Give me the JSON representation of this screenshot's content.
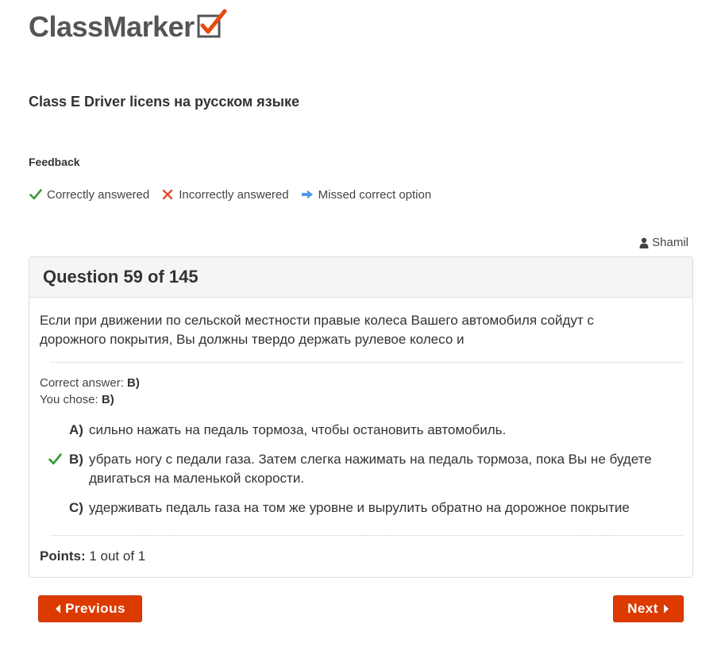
{
  "brand": {
    "name": "ClassMarker",
    "check_color": "#e8490f",
    "text_color": "#555555"
  },
  "quiz": {
    "title": "Class E Driver licens на русском языке"
  },
  "feedback": {
    "title": "Feedback",
    "legend": [
      {
        "icon": "check-icon",
        "label": "Correctly answered",
        "color": "#3c9a3c"
      },
      {
        "icon": "cross-icon",
        "label": "Incorrectly answered",
        "color": "#e24c2c"
      },
      {
        "icon": "arrow-right-icon",
        "label": "Missed correct option",
        "color": "#4d9be6"
      }
    ]
  },
  "user": {
    "icon": "user-icon",
    "name": "Shamil"
  },
  "question": {
    "heading": "Question 59 of 145",
    "text": "Если при движении по сельской местности правые колеса Вашего автомобиля сойдут с дорожного покрытия, Вы должны твердо держать рулевое колесо и",
    "correct_label": "Correct answer:",
    "correct_value": "B)",
    "chose_label": "You chose:",
    "chose_value": "B)",
    "options": [
      {
        "letter": "A)",
        "text": "сильно нажать на педаль тормоза, чтобы остановить автомобиль.",
        "mark": ""
      },
      {
        "letter": "B)",
        "text": "убрать ногу с педали газа. Затем слегка нажимать на педаль тормоза, пока Вы не будете двигаться на маленькой скорости.",
        "mark": "check-icon"
      },
      {
        "letter": "C)",
        "text": "удерживать педаль газа на том же уровне и вырулить обратно на дорожное покрытие",
        "mark": ""
      }
    ],
    "points_label": "Points:",
    "points_value": "1 out of 1"
  },
  "nav": {
    "previous_label": "Previous",
    "next_label": "Next",
    "button_color": "#dd3a00"
  }
}
